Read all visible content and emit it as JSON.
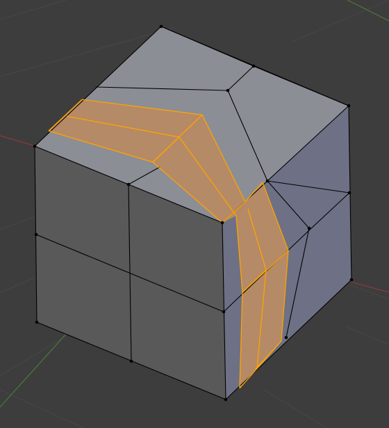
{
  "viewport": {
    "background": "#3d3d3d",
    "grid_color": "#474747",
    "x_axis_color": "#8a3a3a",
    "y_axis_color": "#4a7a3a"
  },
  "mesh": {
    "object": "cube",
    "subdivisions": 2,
    "edge_color": "#000000",
    "vertex_color": "#000000",
    "front_face_color": "#595959",
    "top_face_color": "#8c8e96",
    "side_face_color": "#6e7185",
    "selection_face_color": "#b58a67",
    "selection_edge_color": "#ffa300",
    "selection_type": "edge-loop"
  }
}
